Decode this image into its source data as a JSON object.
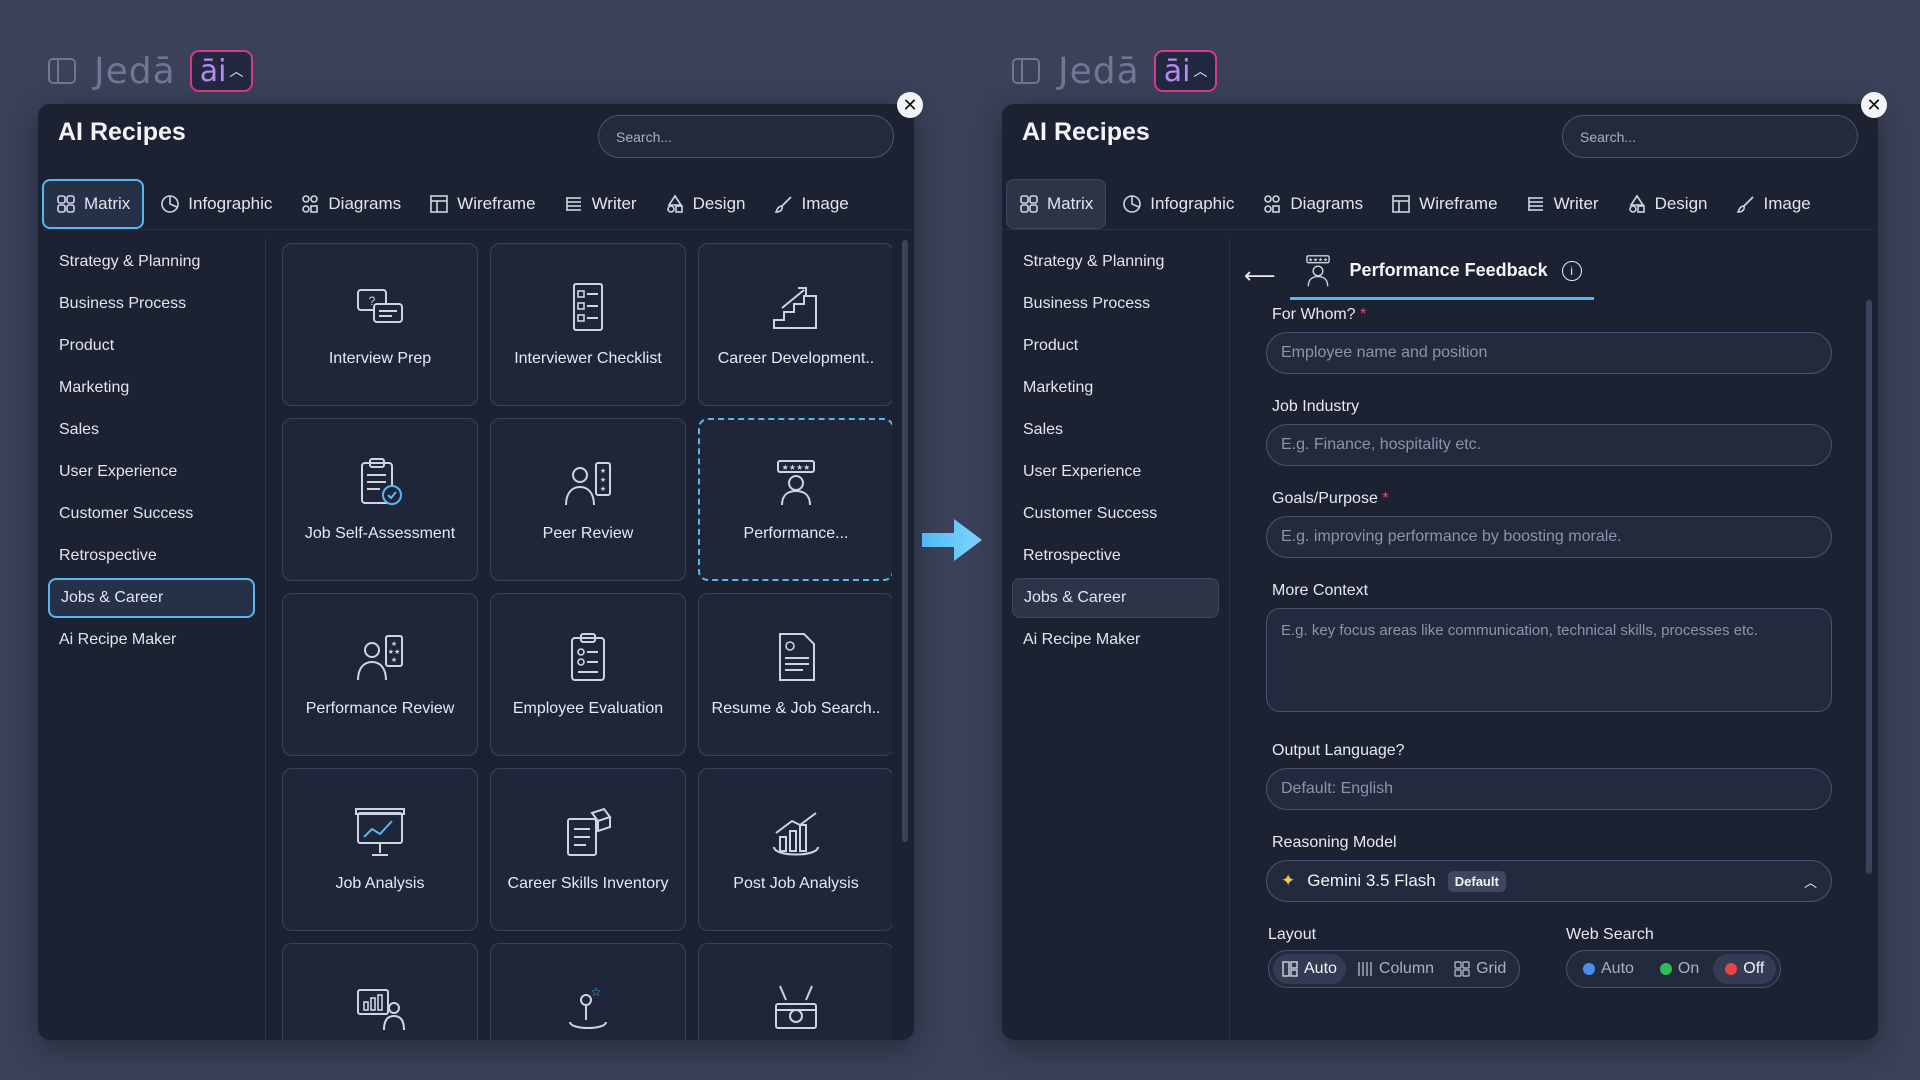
{
  "brand": {
    "logo": "Jedā",
    "ai": "āi"
  },
  "panel_title": "AI Recipes",
  "search_placeholder": "Search...",
  "tabs": [
    {
      "label": "Matrix",
      "icon": "grid-icon"
    },
    {
      "label": "Infographic",
      "icon": "pie-chart-icon"
    },
    {
      "label": "Diagrams",
      "icon": "diagram-icon"
    },
    {
      "label": "Wireframe",
      "icon": "wireframe-icon"
    },
    {
      "label": "Writer",
      "icon": "text-lines-icon"
    },
    {
      "label": "Design",
      "icon": "shapes-icon"
    },
    {
      "label": "Image",
      "icon": "brush-icon"
    }
  ],
  "categories": [
    "Strategy & Planning",
    "Business Process",
    "Product",
    "Marketing",
    "Sales",
    "User Experience",
    "Customer Success",
    "Retrospective",
    "Jobs & Career",
    "Ai Recipe Maker"
  ],
  "active_category": "Jobs & Career",
  "recipes": [
    {
      "label": "Interview Prep",
      "icon": "chat-bubbles-icon"
    },
    {
      "label": "Interviewer Checklist",
      "icon": "checklist-icon"
    },
    {
      "label": "Career Development..",
      "icon": "growth-stairs-icon"
    },
    {
      "label": "Job Self-Assessment",
      "icon": "clipboard-check-icon"
    },
    {
      "label": "Peer Review",
      "icon": "person-rating-icon"
    },
    {
      "label": "Performance...",
      "icon": "person-stars-icon"
    },
    {
      "label": "Performance Review",
      "icon": "person-review-icon"
    },
    {
      "label": "Employee Evaluation",
      "icon": "evaluation-clipboard-icon"
    },
    {
      "label": "Resume & Job Search..",
      "icon": "resume-icon"
    },
    {
      "label": "Job Analysis",
      "icon": "presentation-chart-icon"
    },
    {
      "label": "Career Skills Inventory",
      "icon": "skills-box-icon"
    },
    {
      "label": "Post Job Analysis",
      "icon": "bar-growth-icon"
    },
    {
      "label": "",
      "icon": "presenter-board-icon"
    },
    {
      "label": "",
      "icon": "person-star-icon"
    },
    {
      "label": "",
      "icon": "tools-box-icon"
    }
  ],
  "form": {
    "title": "Performance Feedback",
    "fields": {
      "for_whom": {
        "label": "For Whom?",
        "placeholder": "Employee name and position"
      },
      "industry": {
        "label": "Job Industry",
        "placeholder": "E.g. Finance, hospitality etc."
      },
      "goals": {
        "label": "Goals/Purpose",
        "placeholder": "E.g. improving performance by boosting morale."
      },
      "context": {
        "label": "More Context",
        "placeholder": "E.g. key focus areas like communication, technical skills, processes etc."
      },
      "language": {
        "label": "Output Language?",
        "placeholder": "Default: English"
      }
    },
    "required_mark": "*",
    "model": {
      "label": "Reasoning Model",
      "value": "Gemini 3.5 Flash",
      "badge": "Default"
    },
    "layout": {
      "label": "Layout",
      "options": [
        "Auto",
        "Column",
        "Grid"
      ],
      "selected": "Auto"
    },
    "web_search": {
      "label": "Web Search",
      "options": [
        {
          "label": "Auto",
          "color": "#4a8ef0"
        },
        {
          "label": "On",
          "color": "#2fbf5a"
        },
        {
          "label": "Off",
          "color": "#e84545"
        }
      ],
      "selected": "Off"
    }
  },
  "colors": {
    "accent": "#56b8f0",
    "ai_border": "#d63a8a",
    "panel": "#1d2233",
    "background": "#3a4158"
  }
}
